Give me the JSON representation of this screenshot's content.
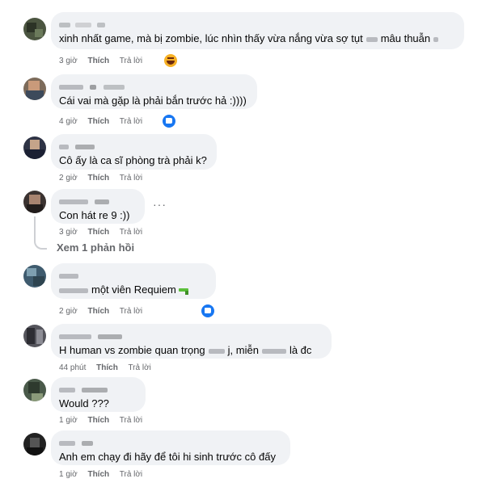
{
  "labels": {
    "like": "Thích",
    "reply": "Trả lời"
  },
  "comments": [
    {
      "text_a": "xinh nhất game, mà bị zombie, lúc nhìn thấy vừa nắng vừa sợ tụt",
      "text_b": "mâu thuẫn",
      "time": "3 giờ",
      "reaction": "haha-icon"
    },
    {
      "text": "Cái vai mà gặp là phải bắn trước hả :))))",
      "time": "4 giờ",
      "reaction": "like-icon"
    },
    {
      "text": "Cô ấy là ca sĩ phòng trà phải k?",
      "time": "2 giờ"
    },
    {
      "text": "Con hát re 9 :))",
      "time": "3 giờ",
      "more": "···"
    },
    {
      "text": "một viên Requiem",
      "time": "2 giờ",
      "reaction": "like-icon"
    },
    {
      "text_a": "H human vs zombie quan trọng",
      "text_b": "j, miễn",
      "text_c": "là đc",
      "time": "44 phút"
    },
    {
      "text": "Would ???",
      "time": "1 giờ"
    },
    {
      "text": "Anh em chạy đi hãy để tôi hi sinh trước cô đấy",
      "time": "1 giờ"
    }
  ],
  "replies_link": "Xem 1 phản hồi",
  "colors": {
    "bubble": "#f0f2f5",
    "meta": "#65676b",
    "like": "#1877f2",
    "thread": "#ced0d4"
  }
}
